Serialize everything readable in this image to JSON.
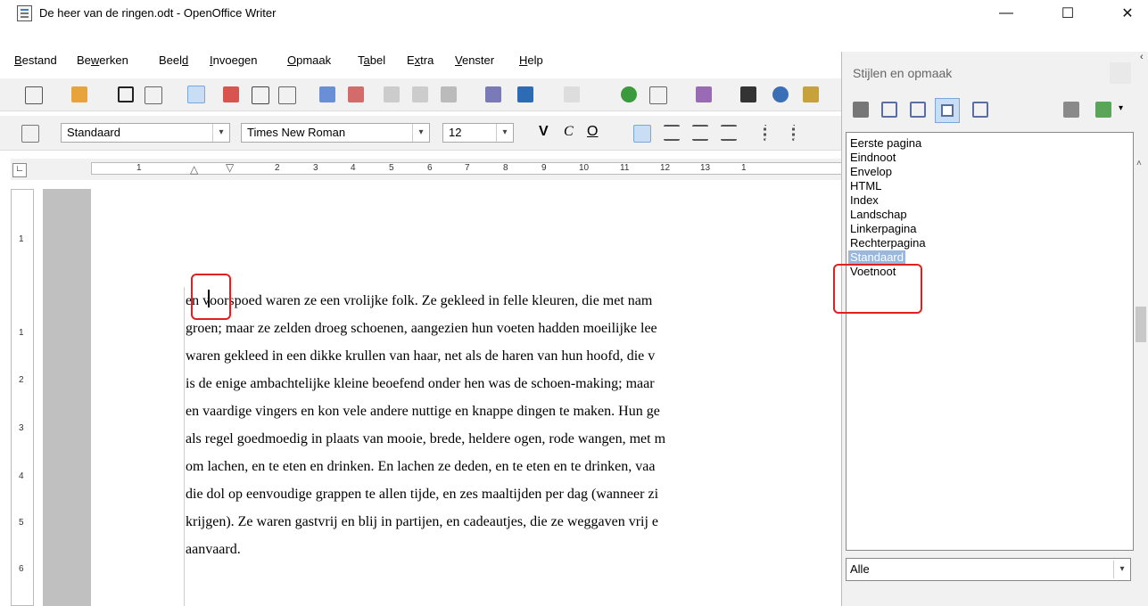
{
  "window": {
    "title": "De heer van de ringen.odt - OpenOffice Writer",
    "min_glyph": "—",
    "max_glyph": "☐",
    "close_glyph": "✕"
  },
  "menu": [
    {
      "pre": "",
      "ul": "B",
      "post": "estand"
    },
    {
      "pre": "Be",
      "ul": "w",
      "post": "erken"
    },
    {
      "pre": "Beel",
      "ul": "d",
      "post": ""
    },
    {
      "pre": "",
      "ul": "I",
      "post": "nvoegen"
    },
    {
      "pre": "",
      "ul": "O",
      "post": "pmaak"
    },
    {
      "pre": "T",
      "ul": "a",
      "post": "bel"
    },
    {
      "pre": "E",
      "ul": "x",
      "post": "tra"
    },
    {
      "pre": "",
      "ul": "V",
      "post": "enster"
    },
    {
      "pre": "",
      "ul": "H",
      "post": "elp"
    }
  ],
  "format": {
    "paragraph_style": "Standaard",
    "font_name": "Times New Roman",
    "font_size": "12",
    "bold": "V",
    "italic": "C",
    "underline": "O"
  },
  "ruler": {
    "labels": [
      "1",
      "2",
      "3",
      "4",
      "5",
      "6",
      "7",
      "8",
      "9",
      "10",
      "11",
      "12",
      "13",
      "1"
    ]
  },
  "vruler": {
    "labels": [
      "1",
      "1",
      "2",
      "3",
      "4",
      "5",
      "6"
    ]
  },
  "document": {
    "lines": [
      "en voorspoed waren ze een vrolijke folk. Ze gekleed in felle kleuren, die met nam",
      "groen; maar ze zelden droeg schoenen, aangezien hun voeten hadden moeilijke lee",
      "waren gekleed in een dikke krullen van haar, net als de haren van hun hoofd, die v",
      "is de enige ambachtelijke kleine beoefend onder hen was de schoen-making; maar",
      "en vaardige vingers en kon vele andere nuttige en knappe dingen te maken. Hun ge",
      "als regel goedmoedig in plaats van mooie, brede, heldere ogen, rode wangen, met m",
      "om lachen, en te eten en drinken. En lachen ze deden, en te eten en te drinken, vaa",
      "die dol op eenvoudige grappen te allen tijde, en zes maaltijden per dag (wanneer zi",
      "krijgen). Ze waren gastvrij en blij in partijen, en cadeautjes, die ze weggaven vrij e",
      "aanvaard."
    ]
  },
  "styles_panel": {
    "title": "Stijlen en opmaak",
    "items": [
      "Eerste pagina",
      "Eindnoot",
      "Envelop",
      "HTML",
      "Index",
      "Landschap",
      "Linkerpagina",
      "Rechterpagina",
      "Standaard",
      "Voetnoot"
    ],
    "selected": "Standaard",
    "filter": "Alle"
  },
  "colors": {
    "accent": "#e02020",
    "selection": "#9ab7dd",
    "doc_bg": "#c0c0c0"
  }
}
